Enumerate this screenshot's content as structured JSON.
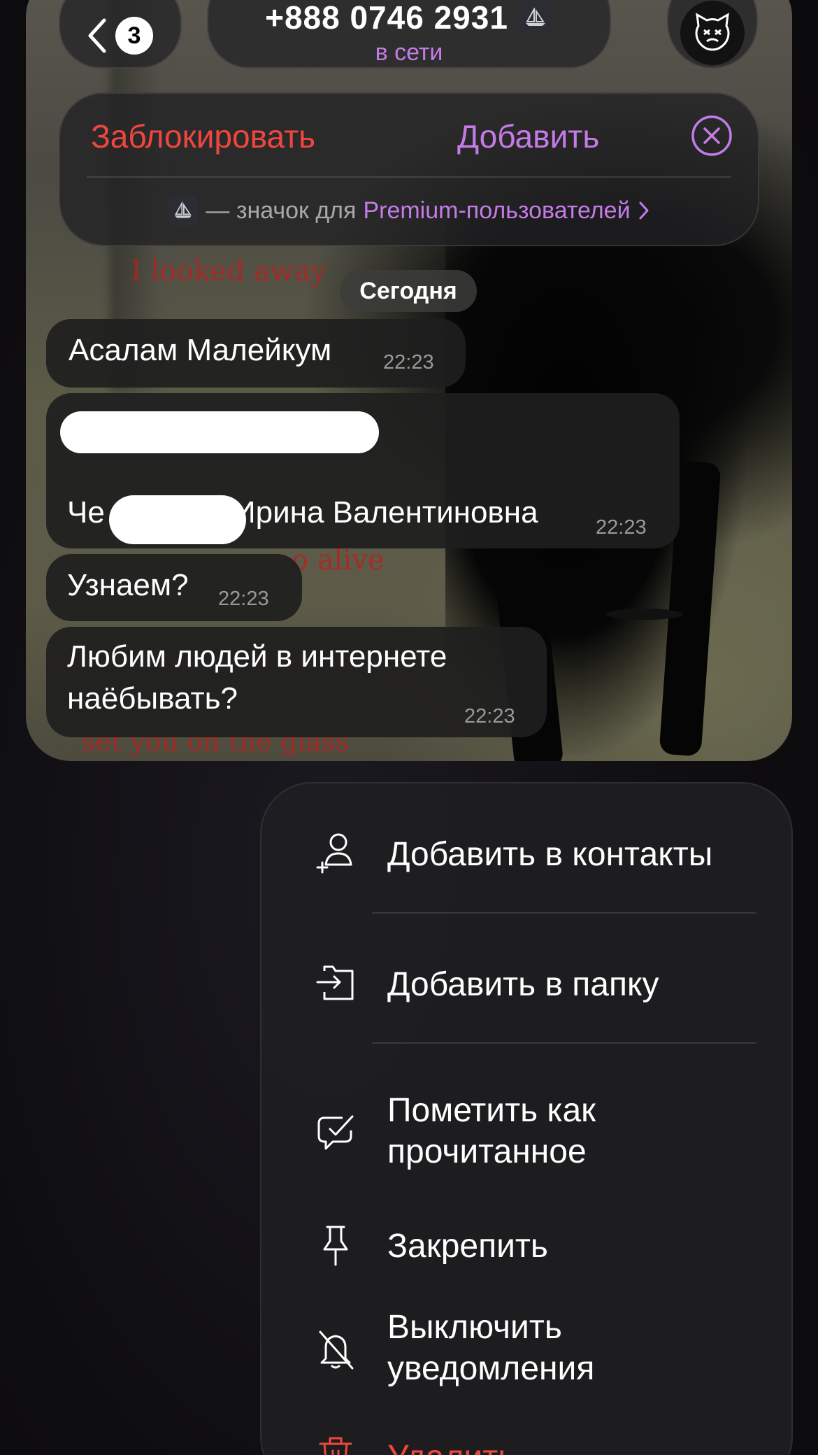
{
  "header": {
    "unread_badge": "3",
    "phone": "+888 0746 2931",
    "status": "в сети"
  },
  "action_bar": {
    "block_label": "Заблокировать",
    "add_label": "Добавить",
    "premium_dash": "— значок для",
    "premium_link": "Premium-пользователей"
  },
  "chat": {
    "date_chip": "Сегодня",
    "messages": [
      {
        "text": "Асалам Малейкум",
        "time": "22:23"
      },
      {
        "text_prefix": "Че",
        "text_suffix": "Ирина Валентиновна",
        "time": "22:23"
      },
      {
        "text": "Узнаем?",
        "time": "22:23"
      },
      {
        "line1": "Любим людей в интернете",
        "line2": "наёбывать?",
        "time": "22:23"
      }
    ],
    "background_text": [
      "I looked away",
      "o alive",
      "set you on the glass"
    ]
  },
  "context_menu": {
    "items": [
      {
        "icon": "add-contact-icon",
        "label": "Добавить в контакты"
      },
      {
        "icon": "add-to-folder-icon",
        "label": "Добавить в папку"
      },
      {
        "icon": "mark-read-icon",
        "line1": "Пометить как",
        "line2": "прочитанное"
      },
      {
        "icon": "pin-icon",
        "label": "Закрепить"
      },
      {
        "icon": "mute-bell-icon",
        "line1": "Выключить",
        "line2": "уведомления"
      },
      {
        "icon": "trash-icon",
        "label": "Удалить"
      }
    ]
  },
  "colors": {
    "accent_purple": "#c57be6",
    "destructive_red": "#f0463e",
    "menu_bg": "#1e1e20"
  }
}
